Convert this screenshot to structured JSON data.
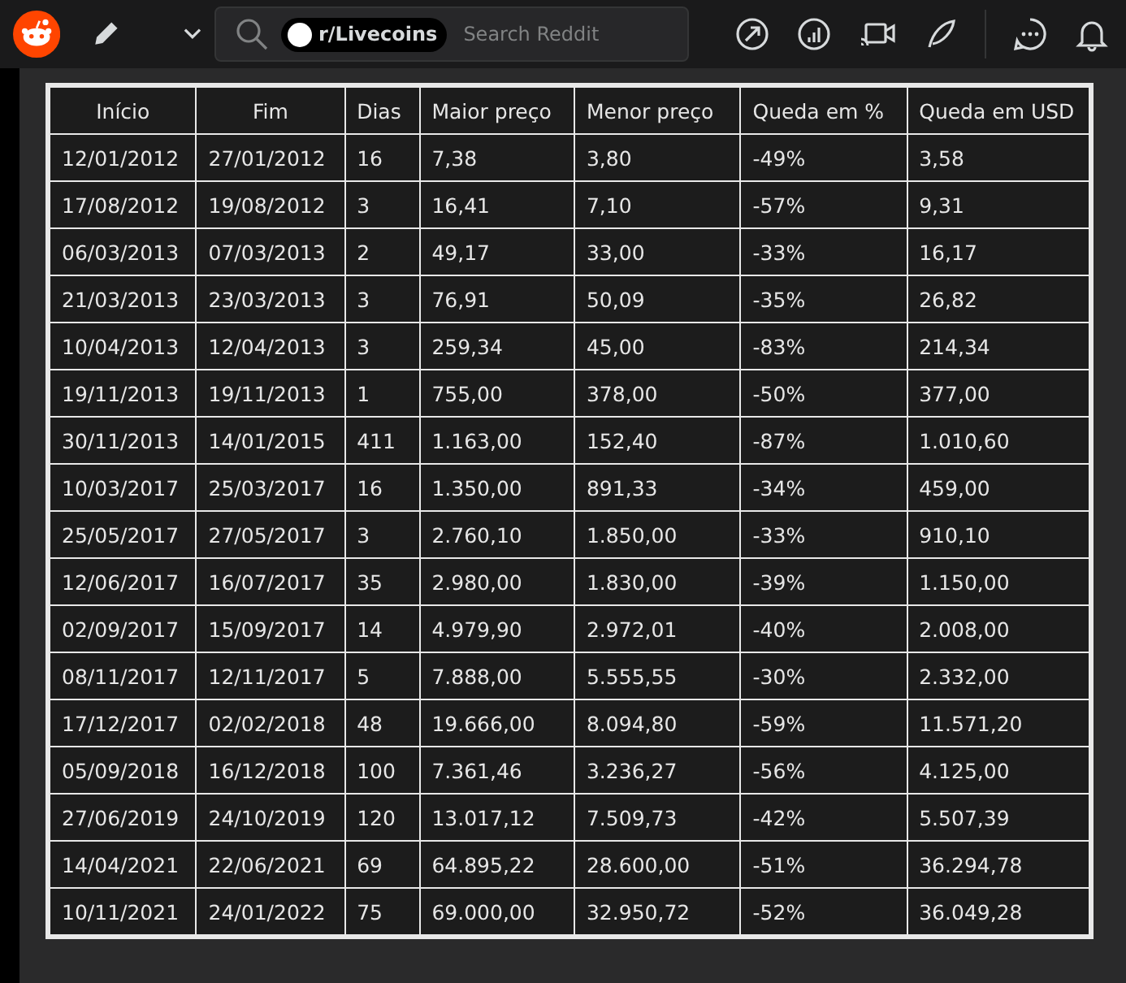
{
  "header": {
    "community": "r/Livecoins",
    "search_placeholder": "Search Reddit"
  },
  "table": {
    "columns": [
      "Início",
      "Fim",
      "Dias",
      "Maior preço",
      "Menor preço",
      "Queda em %",
      "Queda em USD"
    ],
    "rows": [
      [
        "12/01/2012",
        "27/01/2012",
        "16",
        "7,38",
        "3,80",
        "-49%",
        "3,58"
      ],
      [
        "17/08/2012",
        "19/08/2012",
        "3",
        "16,41",
        "7,10",
        "-57%",
        "9,31"
      ],
      [
        "06/03/2013",
        "07/03/2013",
        "2",
        "49,17",
        "33,00",
        "-33%",
        "16,17"
      ],
      [
        "21/03/2013",
        "23/03/2013",
        "3",
        "76,91",
        "50,09",
        "-35%",
        "26,82"
      ],
      [
        "10/04/2013",
        "12/04/2013",
        "3",
        "259,34",
        "45,00",
        "-83%",
        "214,34"
      ],
      [
        "19/11/2013",
        "19/11/2013",
        "1",
        "755,00",
        "378,00",
        "-50%",
        "377,00"
      ],
      [
        "30/11/2013",
        "14/01/2015",
        "411",
        "1.163,00",
        "152,40",
        "-87%",
        "1.010,60"
      ],
      [
        "10/03/2017",
        "25/03/2017",
        "16",
        "1.350,00",
        "891,33",
        "-34%",
        "459,00"
      ],
      [
        "25/05/2017",
        "27/05/2017",
        "3",
        "2.760,10",
        "1.850,00",
        "-33%",
        "910,10"
      ],
      [
        "12/06/2017",
        "16/07/2017",
        "35",
        "2.980,00",
        "1.830,00",
        "-39%",
        "1.150,00"
      ],
      [
        "02/09/2017",
        "15/09/2017",
        "14",
        "4.979,90",
        "2.972,01",
        "-40%",
        "2.008,00"
      ],
      [
        "08/11/2017",
        "12/11/2017",
        "5",
        "7.888,00",
        "5.555,55",
        "-30%",
        "2.332,00"
      ],
      [
        "17/12/2017",
        "02/02/2018",
        "48",
        "19.666,00",
        "8.094,80",
        "-59%",
        "11.571,20"
      ],
      [
        "05/09/2018",
        "16/12/2018",
        "100",
        "7.361,46",
        "3.236,27",
        "-56%",
        "4.125,00"
      ],
      [
        "27/06/2019",
        "24/10/2019",
        "120",
        "13.017,12",
        "7.509,73",
        "-42%",
        "5.507,39"
      ],
      [
        "14/04/2021",
        "22/06/2021",
        "69",
        "64.895,22",
        "28.600,00",
        "-51%",
        "36.294,78"
      ],
      [
        "10/11/2021",
        "24/01/2022",
        "75",
        "69.000,00",
        "32.950,72",
        "-52%",
        "36.049,28"
      ]
    ]
  }
}
